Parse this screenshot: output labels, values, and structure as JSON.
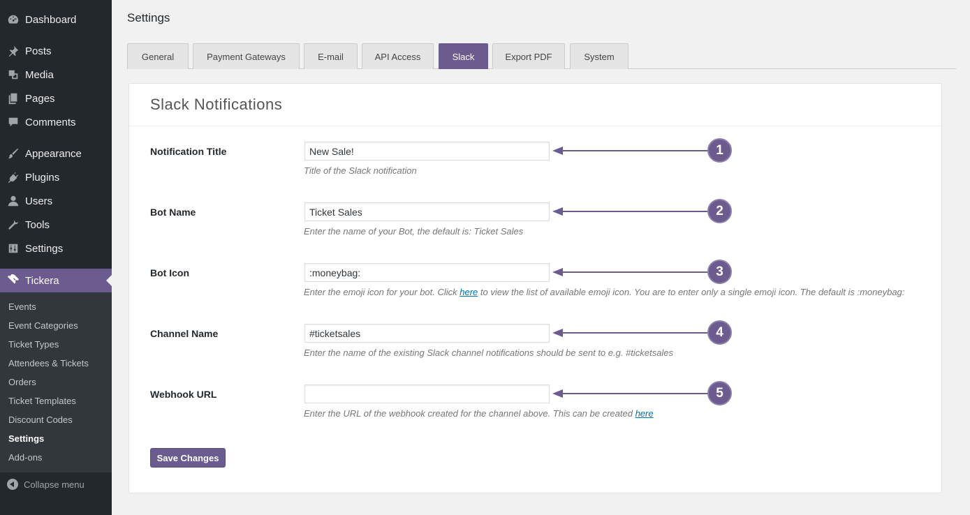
{
  "sidebar": {
    "menu": [
      {
        "label": "Dashboard",
        "icon": "dashboard-icon"
      },
      {
        "label": "Posts",
        "icon": "pin-icon"
      },
      {
        "label": "Media",
        "icon": "media-icon"
      },
      {
        "label": "Pages",
        "icon": "pages-icon"
      },
      {
        "label": "Comments",
        "icon": "comment-icon"
      },
      {
        "label": "Appearance",
        "icon": "brush-icon"
      },
      {
        "label": "Plugins",
        "icon": "plug-icon"
      },
      {
        "label": "Users",
        "icon": "user-icon"
      },
      {
        "label": "Tools",
        "icon": "wrench-icon"
      },
      {
        "label": "Settings",
        "icon": "sliders-icon"
      },
      {
        "label": "Tickera",
        "icon": "ticket-icon"
      }
    ],
    "submenu": [
      "Events",
      "Event Categories",
      "Ticket Types",
      "Attendees & Tickets",
      "Orders",
      "Ticket Templates",
      "Discount Codes",
      "Settings",
      "Add-ons"
    ],
    "collapse_label": "Collapse menu"
  },
  "page": {
    "title": "Settings",
    "tabs": [
      "General",
      "Payment Gateways",
      "E-mail",
      "API Access",
      "Slack",
      "Export PDF",
      "System"
    ],
    "active_tab": "Slack"
  },
  "panel": {
    "title": "Slack Notifications",
    "fields": [
      {
        "label": "Notification Title",
        "value": "New Sale!",
        "desc": "Title of the Slack notification",
        "badge": "1"
      },
      {
        "label": "Bot Name",
        "value": "Ticket Sales",
        "desc": "Enter the name of your Bot, the default is: Ticket Sales",
        "badge": "2"
      },
      {
        "label": "Bot Icon",
        "value": ":moneybag:",
        "desc_before": "Enter the emoji icon for your bot. Click ",
        "desc_link": "here",
        "desc_after": " to view the list of available emoji icon. You are to enter only a single emoji icon. The default is :moneybag:",
        "badge": "3"
      },
      {
        "label": "Channel Name",
        "value": "#ticketsales",
        "desc": "Enter the name of the existing Slack channel notifications should be sent to e.g. #ticketsales",
        "badge": "4"
      },
      {
        "label": "Webhook URL",
        "value": "",
        "desc_before": "Enter the URL of the webhook created for the channel above. This can be created ",
        "desc_link": "here",
        "badge": "5"
      }
    ],
    "save_label": "Save Changes"
  },
  "colors": {
    "accent": "#6c5b8f",
    "sidebar_bg": "#23282d",
    "submenu_bg": "#32373c",
    "link": "#0073aa"
  }
}
